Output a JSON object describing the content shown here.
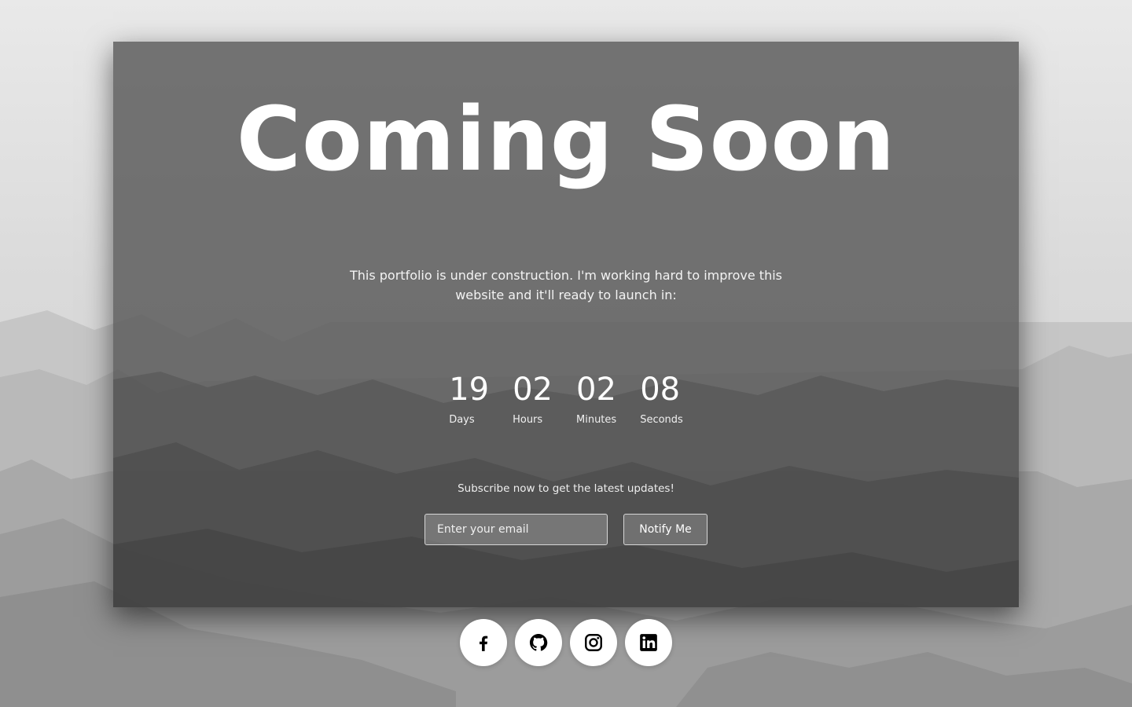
{
  "page": {
    "title": "Coming Soon",
    "description": "This portfolio is under construction. I'm working hard to improve this website and it'll ready to launch in:"
  },
  "countdown": [
    {
      "value": "19",
      "label": "Days"
    },
    {
      "value": "02",
      "label": "Hours"
    },
    {
      "value": "02",
      "label": "Minutes"
    },
    {
      "value": "08",
      "label": "Seconds"
    }
  ],
  "subscribe": {
    "text": "Subscribe now to get the latest updates!",
    "email_placeholder": "Enter your email",
    "button_label": "Notify Me"
  },
  "socials": [
    {
      "icon": "facebook-icon"
    },
    {
      "icon": "github-icon"
    },
    {
      "icon": "instagram-icon"
    },
    {
      "icon": "linkedin-icon"
    }
  ],
  "colors": {
    "card_overlay": "#585858",
    "text": "#ffffff",
    "social_bg": "#ffffff",
    "icon": "#000000"
  }
}
